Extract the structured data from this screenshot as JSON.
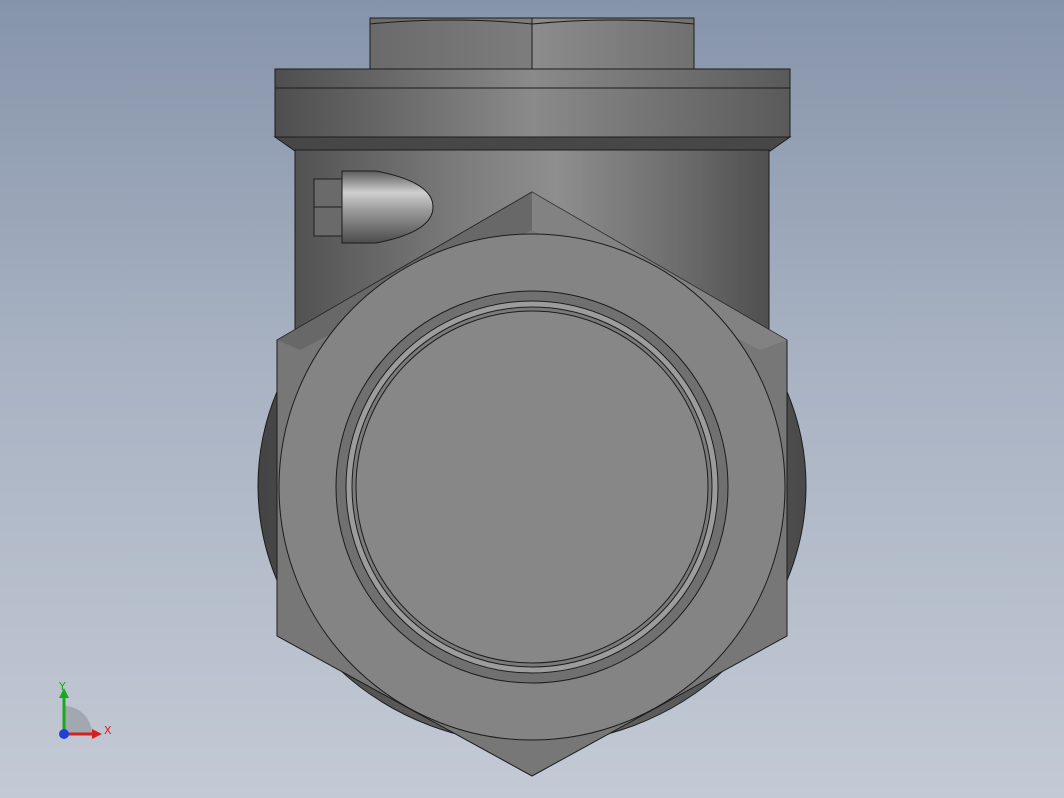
{
  "triad": {
    "x_label": "X",
    "y_label": "Y",
    "x_color": "#d42020",
    "y_color": "#1ca81c",
    "z_color": "#1f3fd8"
  },
  "colors": {
    "background_top": "#8694aa",
    "background_bottom": "#c3cad5",
    "edge": "#1c1c1c"
  }
}
